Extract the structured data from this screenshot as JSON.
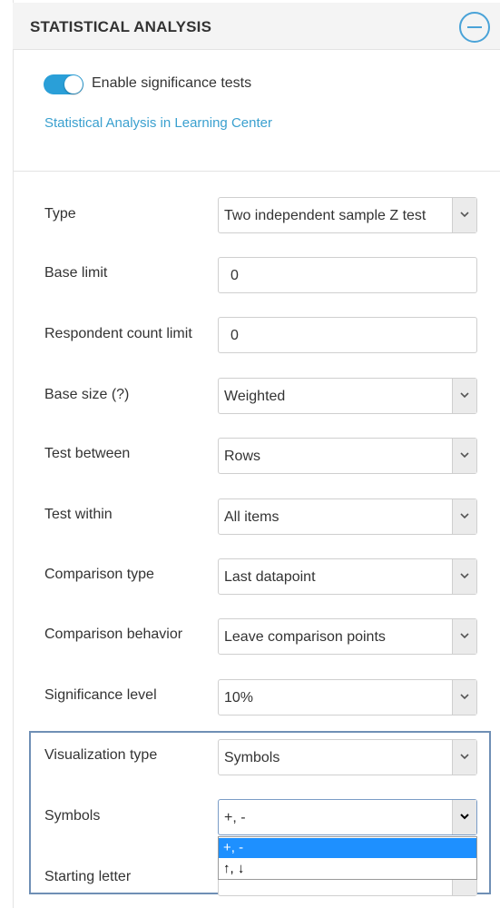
{
  "header": {
    "title": "STATISTICAL ANALYSIS",
    "collapse_icon": "minus-circle-icon",
    "accent": "#4aa3d8"
  },
  "toggle": {
    "label": "Enable significance tests",
    "on": true,
    "color": "#2a9fd8"
  },
  "learn_link": "Statistical Analysis in Learning Center",
  "rows": {
    "type": {
      "label": "Type",
      "value": "Two independent sample Z test"
    },
    "base_limit": {
      "label": "Base limit",
      "value": "0"
    },
    "respondent_count_limit": {
      "label": "Respondent count limit",
      "value": "0"
    },
    "base_size": {
      "label": "Base size (?)",
      "value": "Weighted"
    },
    "test_between": {
      "label": "Test between",
      "value": "Rows"
    },
    "test_within": {
      "label": "Test within",
      "value": "All items"
    },
    "comparison_type": {
      "label": "Comparison type",
      "value": "Last datapoint"
    },
    "comparison_behavior": {
      "label": "Comparison behavior",
      "value": "Leave comparison points"
    },
    "significance_level": {
      "label": "Significance level",
      "value": "10%"
    },
    "visualization_type": {
      "label": "Visualization type",
      "value": "Symbols"
    },
    "symbols": {
      "label": "Symbols",
      "value": "+, -"
    },
    "starting_letter": {
      "label": "Starting letter"
    }
  },
  "symbols_dropdown": {
    "options": [
      "+, -",
      "↑, ↓"
    ],
    "selected_color": "#1e90ff"
  }
}
